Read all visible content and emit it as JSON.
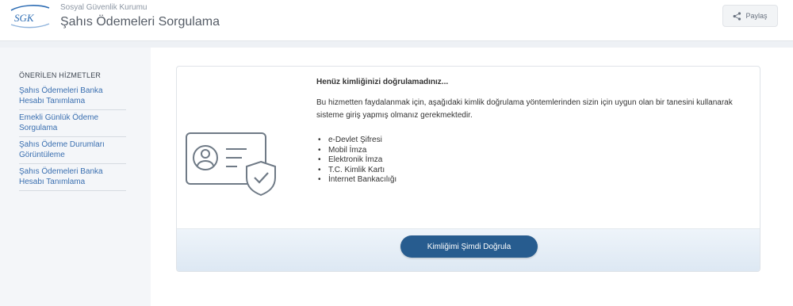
{
  "header": {
    "logo_text": "SGK",
    "org_name": "Sosyal Güvenlik Kurumu",
    "title": "Şahıs Ödemeleri Sorgulama",
    "share_label": "Paylaş",
    "share_icon": "share-icon"
  },
  "sidebar": {
    "heading": "ÖNERİLEN HİZMETLER",
    "items": [
      {
        "label": "Şahıs Ödemeleri Banka Hesabı Tanımlama"
      },
      {
        "label": "Emekli Günlük Ödeme Sorgulama"
      },
      {
        "label": "Şahıs Ödeme Durumları Görüntüleme"
      },
      {
        "label": "Şahıs Ödemeleri Banka Hesabı Tanımlama"
      }
    ]
  },
  "main": {
    "illustration_icon": "identity-card-shield-icon",
    "notice_title": "Henüz kimliğinizi doğrulamadınız...",
    "notice_text": "Bu hizmetten faydalanmak için, aşağıdaki kimlik doğrulama yöntemlerinden sizin için uygun olan bir tanesini kullanarak sisteme giriş yapmış olmanız gerekmektedir.",
    "methods": [
      {
        "label": "e-Devlet Şifresi"
      },
      {
        "label": "Mobil İmza"
      },
      {
        "label": "Elektronik İmza"
      },
      {
        "label": "T.C. Kimlik Kartı"
      },
      {
        "label": "İnternet Bankacılığı"
      }
    ],
    "verify_button": "Kimliğimi Şimdi Doğrula"
  },
  "colors": {
    "primary_button": "#275c8f",
    "link": "#3a6fb0",
    "sidebar_bg": "#f4f6f9",
    "logo_blue": "#2e6db4"
  }
}
